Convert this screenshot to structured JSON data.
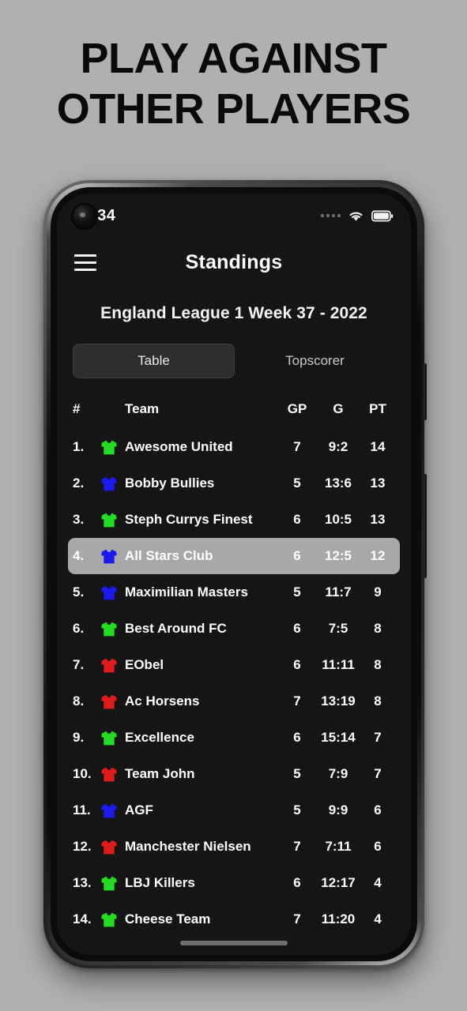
{
  "promo": {
    "headline_line1": "PLAY AGAINST",
    "headline_line2": "OTHER PLAYERS",
    "background_color": "#b0b0b0",
    "text_color": "#0a0a0a"
  },
  "statusbar": {
    "time": "9.34",
    "signal_icon": "signal-dots-icon",
    "wifi_icon": "wifi-icon",
    "battery_icon": "battery-full-icon",
    "camera_icon": "punch-hole-camera-icon"
  },
  "navbar": {
    "menu_icon": "hamburger-menu-icon",
    "title": "Standings"
  },
  "league": {
    "title": "England League 1 Week 37 - 2022"
  },
  "tabs": [
    {
      "label": "Table",
      "active": true
    },
    {
      "label": "Topscorer",
      "active": false
    }
  ],
  "table": {
    "headers": {
      "rank": "#",
      "team": "Team",
      "gp": "GP",
      "g": "G",
      "pt": "PT"
    },
    "highlight_color": "#a8a8a8",
    "jersey_colors": {
      "green": "#22dd22",
      "blue": "#1a1aee",
      "red": "#e01b1b"
    },
    "rows": [
      {
        "rank": "1.",
        "jersey": "green",
        "team": "Awesome United",
        "gp": "7",
        "g": "9:2",
        "pt": "14",
        "highlight": false
      },
      {
        "rank": "2.",
        "jersey": "blue",
        "team": "Bobby Bullies",
        "gp": "5",
        "g": "13:6",
        "pt": "13",
        "highlight": false
      },
      {
        "rank": "3.",
        "jersey": "green",
        "team": "Steph Currys Finest",
        "gp": "6",
        "g": "10:5",
        "pt": "13",
        "highlight": false
      },
      {
        "rank": "4.",
        "jersey": "blue",
        "team": "All Stars Club",
        "gp": "6",
        "g": "12:5",
        "pt": "12",
        "highlight": true
      },
      {
        "rank": "5.",
        "jersey": "blue",
        "team": "Maximilian Masters",
        "gp": "5",
        "g": "11:7",
        "pt": "9",
        "highlight": false
      },
      {
        "rank": "6.",
        "jersey": "green",
        "team": "Best Around FC",
        "gp": "6",
        "g": "7:5",
        "pt": "8",
        "highlight": false
      },
      {
        "rank": "7.",
        "jersey": "red",
        "team": "EObel",
        "gp": "6",
        "g": "11:11",
        "pt": "8",
        "highlight": false
      },
      {
        "rank": "8.",
        "jersey": "red",
        "team": "Ac Horsens",
        "gp": "7",
        "g": "13:19",
        "pt": "8",
        "highlight": false
      },
      {
        "rank": "9.",
        "jersey": "green",
        "team": "Excellence",
        "gp": "6",
        "g": "15:14",
        "pt": "7",
        "highlight": false
      },
      {
        "rank": "10.",
        "jersey": "red",
        "team": "Team John",
        "gp": "5",
        "g": "7:9",
        "pt": "7",
        "highlight": false
      },
      {
        "rank": "11.",
        "jersey": "blue",
        "team": "AGF",
        "gp": "5",
        "g": "9:9",
        "pt": "6",
        "highlight": false
      },
      {
        "rank": "12.",
        "jersey": "red",
        "team": "Manchester Nielsen",
        "gp": "7",
        "g": "7:11",
        "pt": "6",
        "highlight": false
      },
      {
        "rank": "13.",
        "jersey": "green",
        "team": "LBJ Killers",
        "gp": "6",
        "g": "12:17",
        "pt": "4",
        "highlight": false
      },
      {
        "rank": "14.",
        "jersey": "green",
        "team": "Cheese Team",
        "gp": "7",
        "g": "11:20",
        "pt": "4",
        "highlight": false
      }
    ]
  }
}
